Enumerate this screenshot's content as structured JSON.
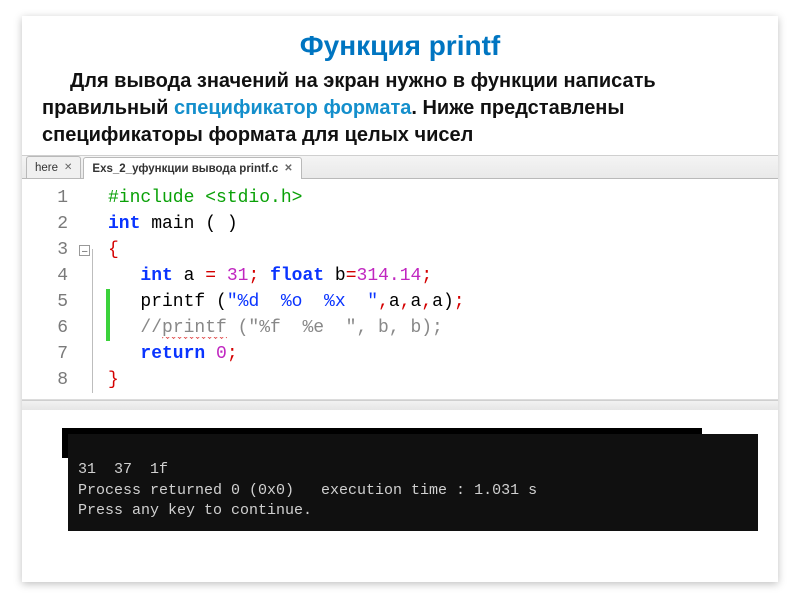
{
  "title": "Функция printf",
  "intro": {
    "part1": "Для вывода значений на экран нужно в функции написать правильный ",
    "highlight": "спецификатор формата",
    "part2": ". Ниже представлены спецификаторы формата для целых чисел"
  },
  "tabs": [
    {
      "label": "here",
      "active": false
    },
    {
      "label": "Exs_2_уфункции вывода printf.c",
      "active": true
    }
  ],
  "code": {
    "lines": [
      {
        "n": 1,
        "tokens": [
          {
            "t": "#include ",
            "c": "c-green"
          },
          {
            "t": "<stdio.h>",
            "c": "c-green"
          }
        ]
      },
      {
        "n": 2,
        "tokens": [
          {
            "t": "int",
            "c": "c-kw"
          },
          {
            "t": " main ",
            "c": ""
          },
          {
            "t": "(",
            "c": ""
          },
          {
            "t": " ",
            "c": ""
          },
          {
            "t": ")",
            "c": ""
          }
        ]
      },
      {
        "n": 3,
        "fold": true,
        "tokens": [
          {
            "t": "{",
            "c": "c-redbrace"
          }
        ]
      },
      {
        "n": 4,
        "tokens": [
          {
            "t": "int",
            "c": "c-kw"
          },
          {
            "t": " a ",
            "c": ""
          },
          {
            "t": "=",
            "c": "c-red"
          },
          {
            "t": " ",
            "c": ""
          },
          {
            "t": "31",
            "c": "c-num"
          },
          {
            "t": ";",
            "c": "c-red"
          },
          {
            "t": " ",
            "c": ""
          },
          {
            "t": "float",
            "c": "c-kw"
          },
          {
            "t": " b",
            "c": ""
          },
          {
            "t": "=",
            "c": "c-red"
          },
          {
            "t": "314.14",
            "c": "c-num"
          },
          {
            "t": ";",
            "c": "c-red"
          }
        ]
      },
      {
        "n": 5,
        "changed": true,
        "tokens": [
          {
            "t": "printf ",
            "c": ""
          },
          {
            "t": "(",
            "c": ""
          },
          {
            "t": "\"%d  %o  %x  \"",
            "c": "c-str"
          },
          {
            "t": ",",
            "c": "c-red"
          },
          {
            "t": "a",
            "c": ""
          },
          {
            "t": ",",
            "c": "c-red"
          },
          {
            "t": "a",
            "c": ""
          },
          {
            "t": ",",
            "c": "c-red"
          },
          {
            "t": "a",
            "c": ""
          },
          {
            "t": ")",
            "c": ""
          },
          {
            "t": ";",
            "c": "c-red"
          }
        ]
      },
      {
        "n": 6,
        "changed": true,
        "tokens": [
          {
            "t": "//",
            "c": "c-gray"
          },
          {
            "t": "printf",
            "c": "c-gray",
            "sq": true
          },
          {
            "t": " (\"%f  %e  \", b, b);",
            "c": "c-gray"
          }
        ]
      },
      {
        "n": 7,
        "tokens": [
          {
            "t": "return",
            "c": "c-kw"
          },
          {
            "t": " ",
            "c": ""
          },
          {
            "t": "0",
            "c": "c-num"
          },
          {
            "t": ";",
            "c": "c-red"
          }
        ]
      },
      {
        "n": 8,
        "tokens": [
          {
            "t": "}",
            "c": "c-redbrace"
          }
        ]
      }
    ]
  },
  "console": {
    "line1": "31  37  1f",
    "line2": "Process returned 0 (0x0)   execution time : 1.031 s",
    "line3": "Press any key to continue."
  }
}
